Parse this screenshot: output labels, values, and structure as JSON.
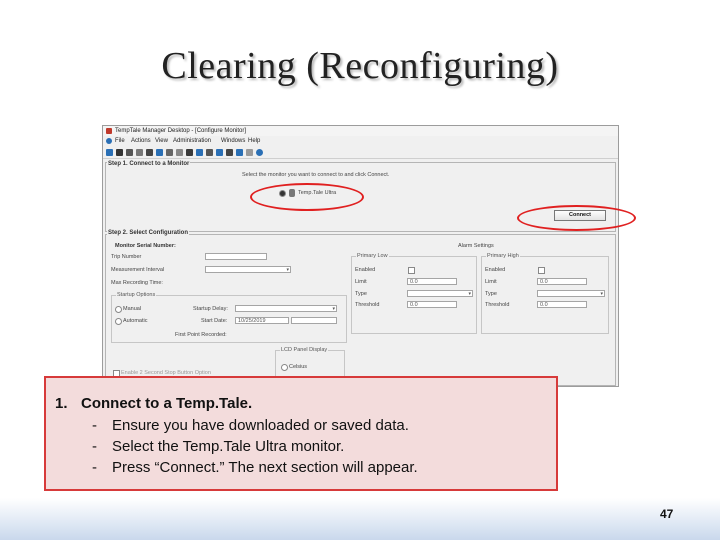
{
  "slide": {
    "title": "Clearing (Reconfiguring)",
    "page_number": "47"
  },
  "window": {
    "title": "TempTale Manager Desktop - [Configure Monitor]",
    "menu": [
      "File",
      "Actions",
      "View",
      "Administration",
      "Windows",
      "Help"
    ]
  },
  "step1": {
    "label": "Step 1. Connect to a Monitor",
    "instruction": "Select the monitor you want to connect to and click Connect.",
    "option_label": "Temp.Tale Ultra",
    "connect_label": "Connect"
  },
  "step2": {
    "label": "Step 2. Select Configuration",
    "monitor_serial_label": "Monitor Serial Number:",
    "trip_number_label": "Trip Number",
    "measurement_interval_label": "Measurement Interval",
    "max_recording_label": "Max Recording Time:",
    "startup_options": {
      "title": "Startup Options",
      "manual": "Manual",
      "automatic": "Automatic",
      "startup_delay_label": "Startup Delay:",
      "start_date_label": "Start Date:",
      "start_date_value": "10/25/2019",
      "first_point_label": "First Point Recorded:"
    },
    "alarm_settings": {
      "title": "Alarm Settings",
      "primary_low": {
        "title": "Primary Low",
        "enabled": "Enabled",
        "limit": "Limit",
        "limit_value": "0.0",
        "type": "Type",
        "threshold": "Threshold",
        "threshold_value": "0.0"
      },
      "primary_high": {
        "title": "Primary High",
        "enabled": "Enabled",
        "limit": "Limit",
        "limit_value": "0.0",
        "type": "Type",
        "threshold": "Threshold",
        "threshold_value": "0.0"
      }
    },
    "lcd_panel": {
      "title": "LCD Panel Display",
      "celsius": "Celsius"
    },
    "stop_button": "Enable 2 Second Stop Button Option"
  },
  "callout": {
    "number": "1.",
    "heading": "Connect to a Temp.Tale.",
    "bullets": [
      "Ensure you have downloaded or saved data.",
      "Select the Temp.Tale Ultra monitor.",
      "Press “Connect.” The next section will appear."
    ],
    "dash": "-"
  },
  "colors": {
    "highlight": "#e02020",
    "callout_fill": "#f3dcdc",
    "callout_border": "#d73a3a"
  }
}
